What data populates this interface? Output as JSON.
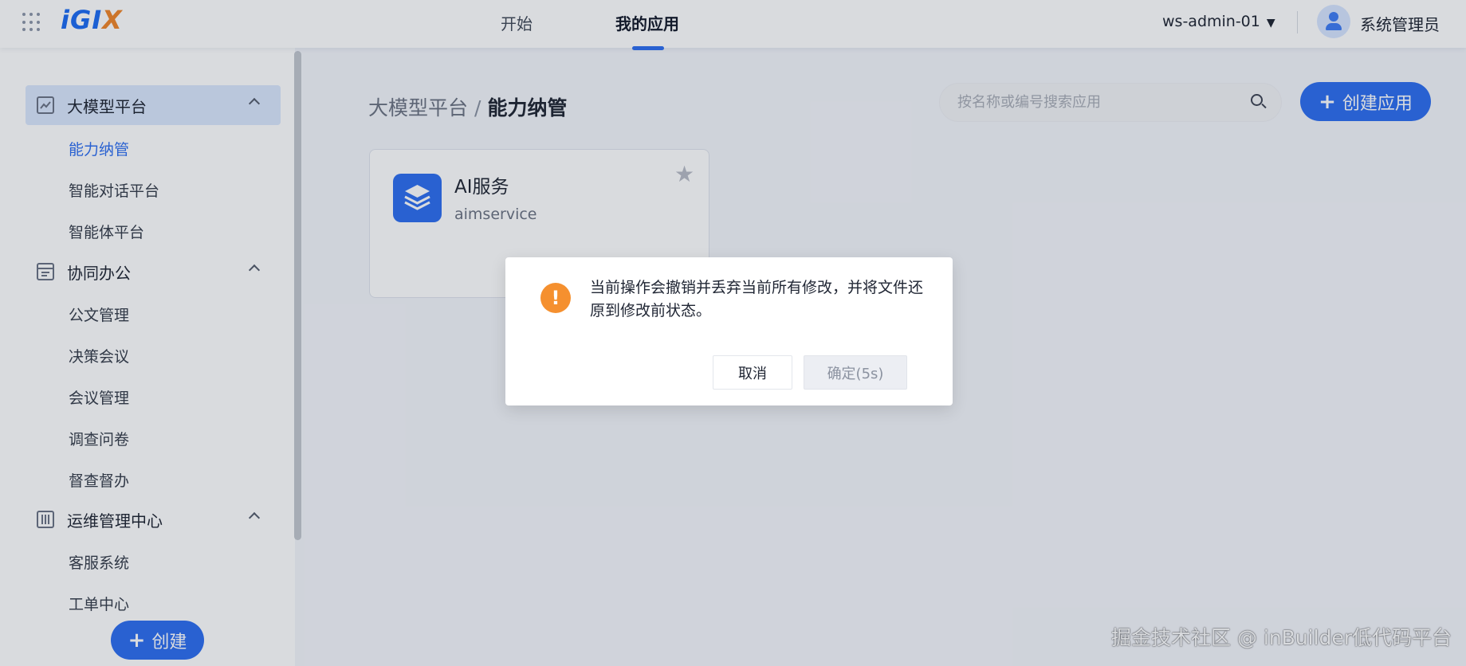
{
  "header": {
    "logo": {
      "i": "i",
      "g": "G",
      "l": "I",
      "x": "X"
    },
    "nav": [
      {
        "label": "开始",
        "active": false
      },
      {
        "label": "我的应用",
        "active": true
      }
    ],
    "workspace": "ws-admin-01",
    "workspace_caret": "▼",
    "username": "系统管理员"
  },
  "sidebar": {
    "groups": [
      {
        "label": "大模型平台",
        "icon": "chart-icon",
        "expanded": true,
        "active": true,
        "items": [
          {
            "label": "能力纳管",
            "active": true
          },
          {
            "label": "智能对话平台",
            "active": false
          },
          {
            "label": "智能体平台",
            "active": false
          }
        ]
      },
      {
        "label": "协同办公",
        "icon": "document-list-icon",
        "expanded": true,
        "active": false,
        "items": [
          {
            "label": "公文管理"
          },
          {
            "label": "决策会议"
          },
          {
            "label": "会议管理"
          },
          {
            "label": "调查问卷"
          },
          {
            "label": "督查督办"
          }
        ]
      },
      {
        "label": "运维管理中心",
        "icon": "sliders-icon",
        "expanded": true,
        "active": false,
        "items": [
          {
            "label": "客服系统"
          },
          {
            "label": "工单中心"
          }
        ]
      }
    ],
    "create_button": {
      "plus": "+",
      "label": "创建"
    }
  },
  "main": {
    "breadcrumb": {
      "parent": "大模型平台",
      "separator": "/",
      "current": "能力纳管"
    },
    "search": {
      "placeholder": "按名称或编号搜索应用",
      "value": ""
    },
    "create_app": {
      "plus": "+",
      "label": "创建应用"
    },
    "cards": [
      {
        "name": "AI服务",
        "code": "aimservice",
        "icon": "layers-icon",
        "starred": false
      }
    ]
  },
  "dialog": {
    "icon": "!",
    "message": "当前操作会撤销并丢弃当前所有修改，并将文件还原到修改前状态。",
    "cancel_label": "取消",
    "confirm_label": "确定(5s)"
  },
  "watermark": "掘金技术社区 @ inBuilder低代码平台",
  "colors": {
    "accent": "#2e6ef0",
    "warning": "#f5902f",
    "logo_x": "#f0862a"
  }
}
